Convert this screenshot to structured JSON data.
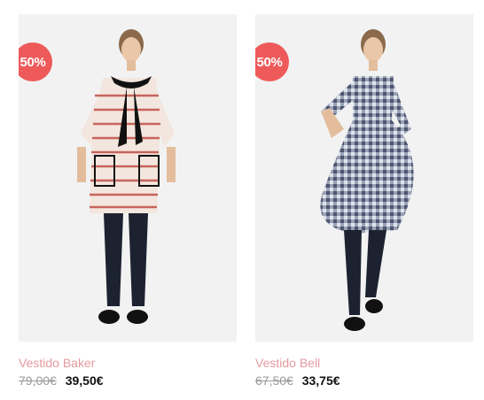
{
  "products": [
    {
      "badge": "50%",
      "name": "Vestido Baker",
      "old_price": "79,00€",
      "new_price": "39,50€",
      "dress_color": "#f3e6de",
      "stripe_color": "#c7645c"
    },
    {
      "badge": "50%",
      "name": "Vestido Bell",
      "old_price": "67,50€",
      "new_price": "33,75€",
      "dress_color": "#8a93a8",
      "stripe_color": "#3f465e"
    }
  ],
  "colors": {
    "badge": "#ee5a5a",
    "product_name": "#e49a9e",
    "image_bg": "#f2f2f2"
  }
}
